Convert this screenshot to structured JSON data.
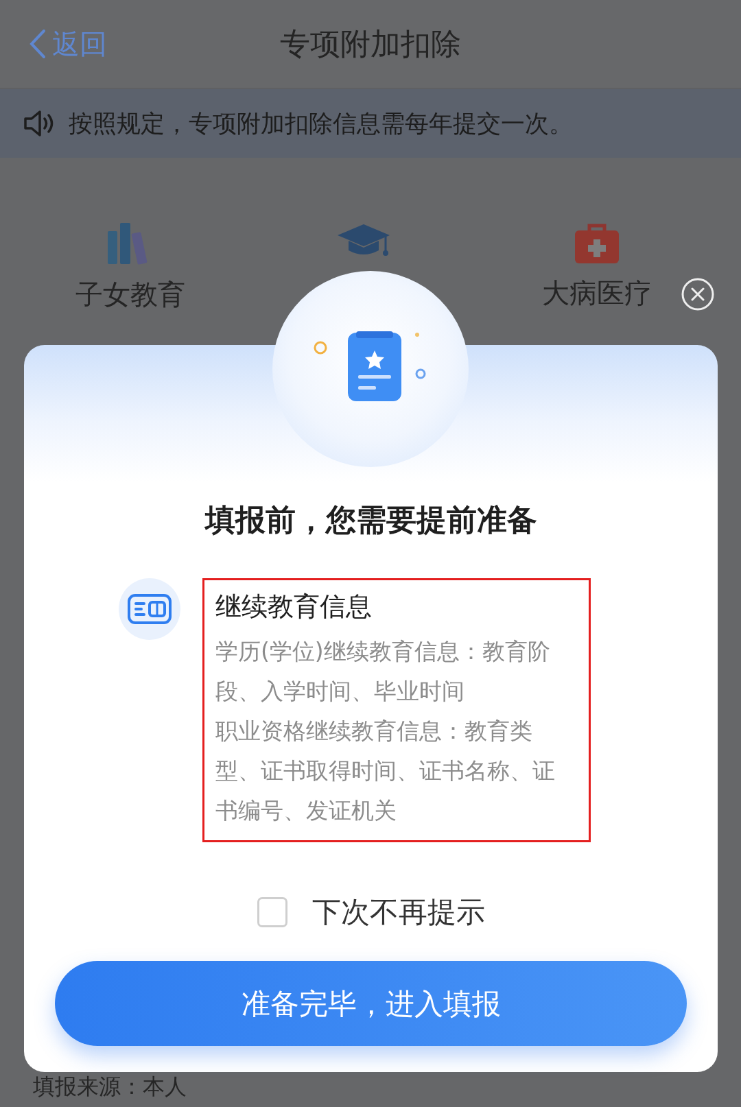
{
  "nav": {
    "back_label": "返回",
    "title": "专项附加扣除"
  },
  "notice": {
    "text": "按照规定，专项附加扣除信息需每年提交一次。"
  },
  "categories": [
    {
      "kind": "books",
      "label": "子女教育"
    },
    {
      "kind": "cap"
    },
    {
      "kind": "medkit",
      "label": "大病医疗"
    }
  ],
  "footer_text": "填报来源：本人",
  "dialog": {
    "title": "填报前，您需要提前准备",
    "items": [
      {
        "title": "继续教育信息",
        "highlighted": true,
        "lines": [
          "学历(学位)继续教育信息：教育阶段、入学时间、毕业时间",
          "职业资格继续教育信息：教育类型、证书取得时间、证书名称、证书编号、发证机关"
        ]
      }
    ],
    "dont_remind": {
      "label": "下次不再提示",
      "checked": false
    },
    "confirm_button": "准备完毕，进入填报"
  }
}
